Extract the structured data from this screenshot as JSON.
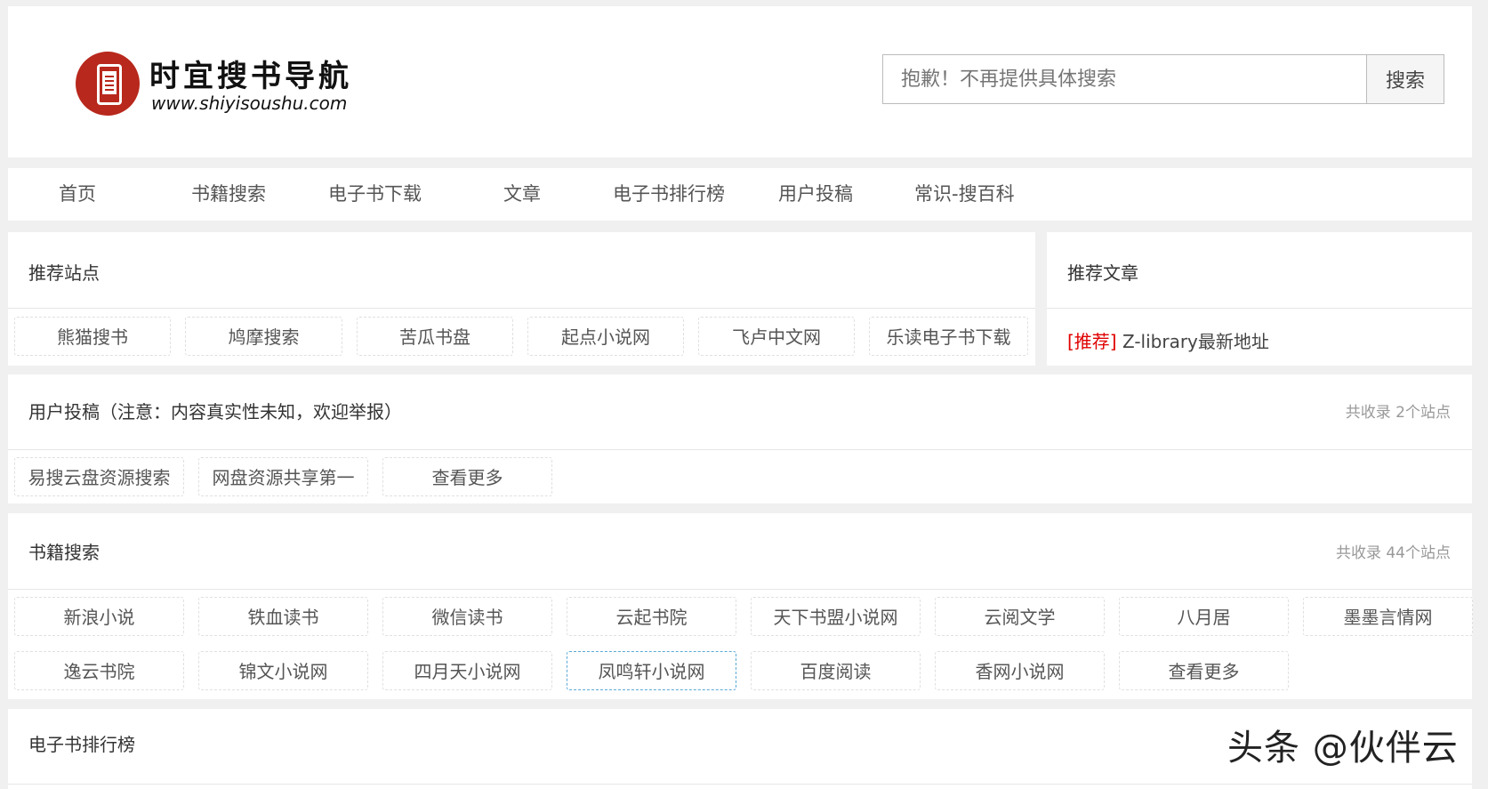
{
  "site": {
    "title": "时宜搜书导航",
    "url": "www.shiyisoushu.com",
    "brand_color": "#b8281c"
  },
  "search": {
    "placeholder": "抱歉！不再提供具体搜索",
    "button_label": "搜索"
  },
  "nav": {
    "items": [
      "首页",
      "书籍搜索",
      "电子书下载",
      "文章",
      "电子书排行榜",
      "用户投稿",
      "常识-搜百科"
    ]
  },
  "recommended_sites": {
    "title": "推荐站点",
    "items": [
      "熊猫搜书",
      "鸠摩搜索",
      "苦瓜书盘",
      "起点小说网",
      "飞卢中文网",
      "乐读电子书下载"
    ]
  },
  "recommended_articles": {
    "title": "推荐文章",
    "items": [
      {
        "prefix": "[推荐]",
        "text": " Z-library最新地址",
        "prefix_color": "#e00000"
      }
    ]
  },
  "user_submissions": {
    "title": "用户投稿（注意：内容真实性未知，欢迎举报）",
    "count": "共收录 2个站点",
    "items": [
      "易搜云盘资源搜索",
      "网盘资源共享第一",
      "查看更多"
    ]
  },
  "book_search": {
    "title": "书籍搜索",
    "count": "共收录 44个站点",
    "items": [
      "新浪小说",
      "铁血读书",
      "微信读书",
      "云起书院",
      "天下书盟小说网",
      "云阅文学",
      "八月居",
      "墨墨言情网",
      "逸云书院",
      "锦文小说网",
      "四月天小说网",
      "凤鸣轩小说网",
      "百度阅读",
      "香网小说网",
      "查看更多"
    ],
    "highlighted": "凤鸣轩小说网"
  },
  "ebook_ranking": {
    "title": "电子书排行榜"
  },
  "watermark": "头条 @伙伴云"
}
